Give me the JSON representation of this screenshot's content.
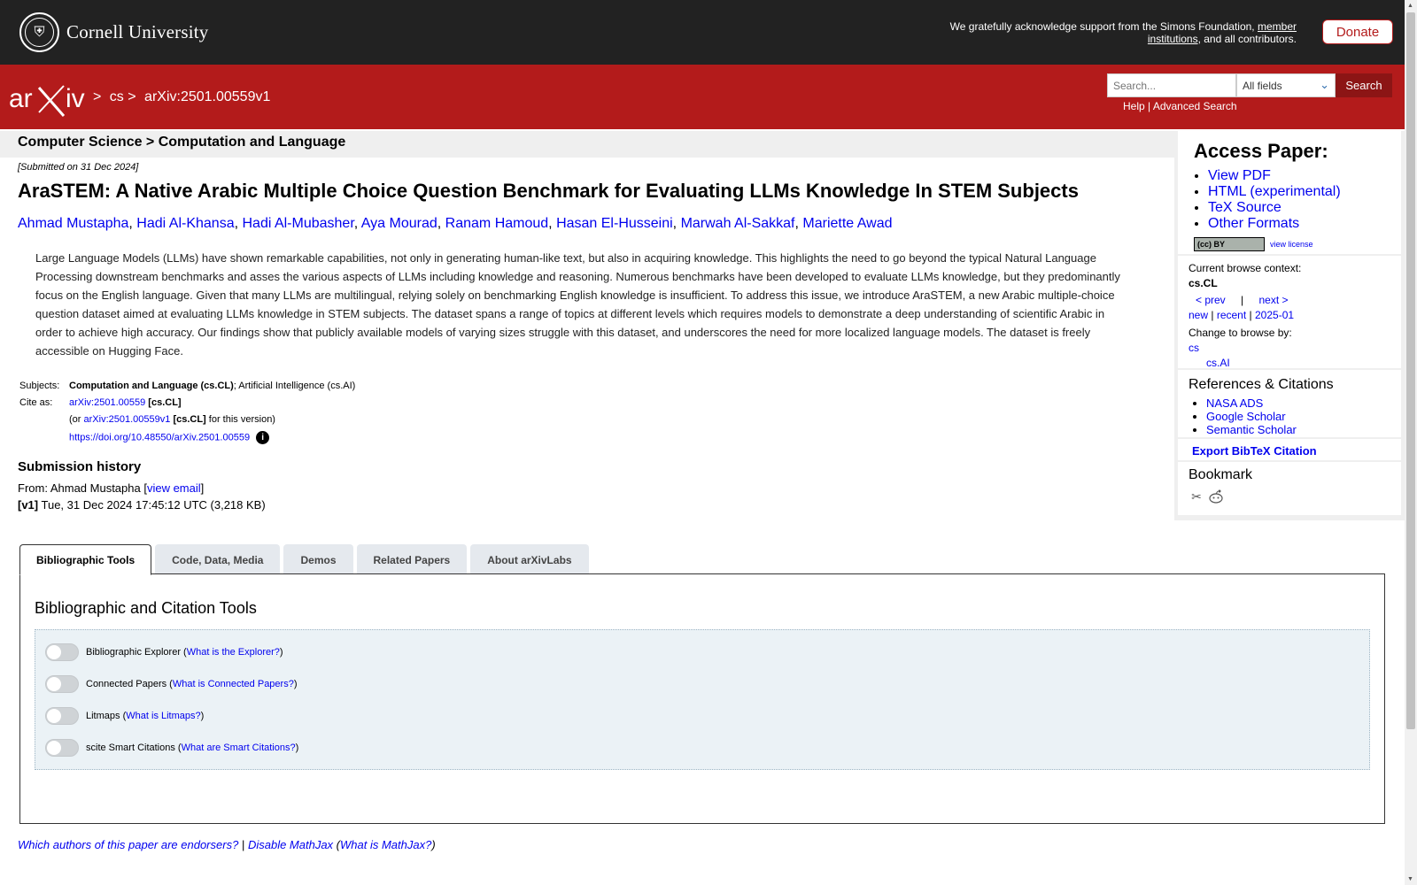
{
  "topbar": {
    "university": "Cornell University",
    "ack_text": "We gratefully acknowledge support from the Simons Foundation,",
    "ack_link": "member institutions",
    "ack_tail": ", and all contributors.",
    "donate_label": "Donate"
  },
  "header": {
    "logo_text": "arXiv",
    "crumb_sep1": ">",
    "crumb_cs": "cs",
    "crumb_sep2": ">",
    "crumb_id": "arXiv:2501.00559v1",
    "search_placeholder": "Search...",
    "search_field": "All fields",
    "search_button": "Search",
    "help_link": "Help",
    "link_sep": "|",
    "advanced_link": "Advanced Search"
  },
  "paper": {
    "subject_breadcrumb": "Computer Science > Computation and Language",
    "submitted": "[Submitted on 31 Dec 2024]",
    "title": "AraSTEM: A Native Arabic Multiple Choice Question Benchmark for Evaluating LLMs Knowledge In STEM Subjects",
    "authors": [
      "Ahmad Mustapha",
      "Hadi Al-Khansa",
      "Hadi Al-Mubasher",
      "Aya Mourad",
      "Ranam Hamoud",
      "Hasan El-Husseini",
      "Marwah Al-Sakkaf",
      "Mariette Awad"
    ],
    "abstract": "Large Language Models (LLMs) have shown remarkable capabilities, not only in generating human-like text, but also in acquiring knowledge. This highlights the need to go beyond the typical Natural Language Processing downstream benchmarks and asses the various aspects of LLMs including knowledge and reasoning. Numerous benchmarks have been developed to evaluate LLMs knowledge, but they predominantly focus on the English language. Given that many LLMs are multilingual, relying solely on benchmarking English knowledge is insufficient. To address this issue, we introduce AraSTEM, a new Arabic multiple-choice question dataset aimed at evaluating LLMs knowledge in STEM subjects. The dataset spans a range of topics at different levels which requires models to demonstrate a deep understanding of scientific Arabic in order to achieve high accuracy. Our findings show that publicly available models of varying sizes struggle with this dataset, and underscores the need for more localized language models. The dataset is freely accessible on Hugging Face.",
    "subjects_label": "Subjects:",
    "subjects_primary": "Computation and Language (cs.CL)",
    "subjects_rest": "; Artificial Intelligence (cs.AI)",
    "cite_label": "Cite as:",
    "cite_id": "arXiv:2501.00559",
    "cite_cat": "[cs.CL]",
    "cite_or": "(or",
    "cite_version_id": "arXiv:2501.00559v1",
    "cite_version_cat": "[cs.CL]",
    "cite_version_tail": "for this version)",
    "doi": "https://doi.org/10.48550/arXiv.2501.00559",
    "info_icon": "i",
    "history_title": "Submission history",
    "from_text": "From: Ahmad Mustapha [",
    "view_email": "view email",
    "from_close": "]",
    "v1_label": "[v1]",
    "v1_text": "Tue, 31 Dec 2024 17:45:12 UTC (3,218 KB)"
  },
  "sidebar": {
    "access_title": "Access Paper:",
    "access_links": [
      "View PDF",
      "HTML (experimental)",
      "TeX Source",
      "Other Formats"
    ],
    "cc_text": "(cc) BY",
    "view_license": "view license",
    "browse_label": "Current browse context:",
    "browse_context": "cs.CL",
    "prev": "< prev",
    "browse_sep": "|",
    "next": "next >",
    "new": "new",
    "recent": "recent",
    "month": "2025-01",
    "change_label": "Change to browse by:",
    "browse_cs": "cs",
    "browse_csai": "cs.AI",
    "refs_title": "References & Citations",
    "refs_links": [
      "NASA ADS",
      "Google Scholar",
      "Semantic Scholar"
    ],
    "bibtex": "Export BibTeX Citation",
    "bookmark_title": "Bookmark",
    "bookmark_icons": [
      "bibsonomy-icon",
      "reddit-icon"
    ]
  },
  "tabs": {
    "items": [
      "Bibliographic Tools",
      "Code, Data, Media",
      "Demos",
      "Related Papers",
      "About arXivLabs"
    ],
    "active_index": 0,
    "panel_title": "Bibliographic and Citation Tools",
    "tools": [
      {
        "name": "Bibliographic Explorer",
        "link": "What is the Explorer?"
      },
      {
        "name": "Connected Papers",
        "link": "What is Connected Papers?"
      },
      {
        "name": "Litmaps",
        "link": "What is Litmaps?"
      },
      {
        "name": "scite Smart Citations",
        "link": "What are Smart Citations?"
      }
    ]
  },
  "footer": {
    "endorsers": "Which authors of this paper are endorsers?",
    "sep": "|",
    "mathjax": "Disable MathJax",
    "what_mathjax": "What is MathJax?"
  },
  "colors": {
    "topbar": "#222222",
    "brand_red": "#b31b1b",
    "link": "#0000ee",
    "tools_bg": "#ebf2f6"
  }
}
